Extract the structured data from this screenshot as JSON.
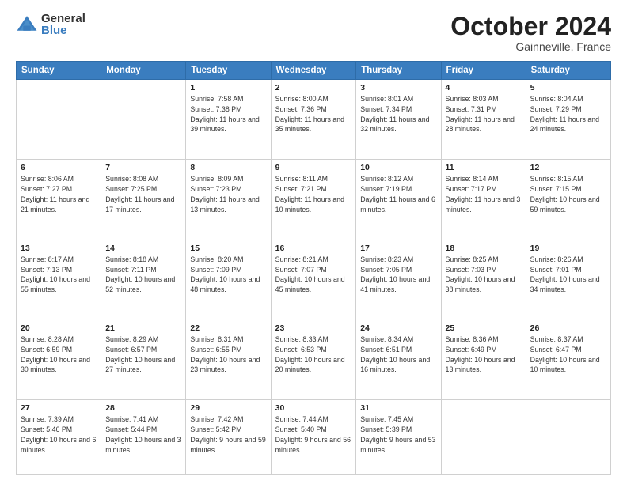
{
  "logo": {
    "general": "General",
    "blue": "Blue"
  },
  "header": {
    "month": "October 2024",
    "location": "Gainneville, France"
  },
  "weekdays": [
    "Sunday",
    "Monday",
    "Tuesday",
    "Wednesday",
    "Thursday",
    "Friday",
    "Saturday"
  ],
  "weeks": [
    [
      {
        "day": "",
        "sunrise": "",
        "sunset": "",
        "daylight": ""
      },
      {
        "day": "",
        "sunrise": "",
        "sunset": "",
        "daylight": ""
      },
      {
        "day": "1",
        "sunrise": "Sunrise: 7:58 AM",
        "sunset": "Sunset: 7:38 PM",
        "daylight": "Daylight: 11 hours and 39 minutes."
      },
      {
        "day": "2",
        "sunrise": "Sunrise: 8:00 AM",
        "sunset": "Sunset: 7:36 PM",
        "daylight": "Daylight: 11 hours and 35 minutes."
      },
      {
        "day": "3",
        "sunrise": "Sunrise: 8:01 AM",
        "sunset": "Sunset: 7:34 PM",
        "daylight": "Daylight: 11 hours and 32 minutes."
      },
      {
        "day": "4",
        "sunrise": "Sunrise: 8:03 AM",
        "sunset": "Sunset: 7:31 PM",
        "daylight": "Daylight: 11 hours and 28 minutes."
      },
      {
        "day": "5",
        "sunrise": "Sunrise: 8:04 AM",
        "sunset": "Sunset: 7:29 PM",
        "daylight": "Daylight: 11 hours and 24 minutes."
      }
    ],
    [
      {
        "day": "6",
        "sunrise": "Sunrise: 8:06 AM",
        "sunset": "Sunset: 7:27 PM",
        "daylight": "Daylight: 11 hours and 21 minutes."
      },
      {
        "day": "7",
        "sunrise": "Sunrise: 8:08 AM",
        "sunset": "Sunset: 7:25 PM",
        "daylight": "Daylight: 11 hours and 17 minutes."
      },
      {
        "day": "8",
        "sunrise": "Sunrise: 8:09 AM",
        "sunset": "Sunset: 7:23 PM",
        "daylight": "Daylight: 11 hours and 13 minutes."
      },
      {
        "day": "9",
        "sunrise": "Sunrise: 8:11 AM",
        "sunset": "Sunset: 7:21 PM",
        "daylight": "Daylight: 11 hours and 10 minutes."
      },
      {
        "day": "10",
        "sunrise": "Sunrise: 8:12 AM",
        "sunset": "Sunset: 7:19 PM",
        "daylight": "Daylight: 11 hours and 6 minutes."
      },
      {
        "day": "11",
        "sunrise": "Sunrise: 8:14 AM",
        "sunset": "Sunset: 7:17 PM",
        "daylight": "Daylight: 11 hours and 3 minutes."
      },
      {
        "day": "12",
        "sunrise": "Sunrise: 8:15 AM",
        "sunset": "Sunset: 7:15 PM",
        "daylight": "Daylight: 10 hours and 59 minutes."
      }
    ],
    [
      {
        "day": "13",
        "sunrise": "Sunrise: 8:17 AM",
        "sunset": "Sunset: 7:13 PM",
        "daylight": "Daylight: 10 hours and 55 minutes."
      },
      {
        "day": "14",
        "sunrise": "Sunrise: 8:18 AM",
        "sunset": "Sunset: 7:11 PM",
        "daylight": "Daylight: 10 hours and 52 minutes."
      },
      {
        "day": "15",
        "sunrise": "Sunrise: 8:20 AM",
        "sunset": "Sunset: 7:09 PM",
        "daylight": "Daylight: 10 hours and 48 minutes."
      },
      {
        "day": "16",
        "sunrise": "Sunrise: 8:21 AM",
        "sunset": "Sunset: 7:07 PM",
        "daylight": "Daylight: 10 hours and 45 minutes."
      },
      {
        "day": "17",
        "sunrise": "Sunrise: 8:23 AM",
        "sunset": "Sunset: 7:05 PM",
        "daylight": "Daylight: 10 hours and 41 minutes."
      },
      {
        "day": "18",
        "sunrise": "Sunrise: 8:25 AM",
        "sunset": "Sunset: 7:03 PM",
        "daylight": "Daylight: 10 hours and 38 minutes."
      },
      {
        "day": "19",
        "sunrise": "Sunrise: 8:26 AM",
        "sunset": "Sunset: 7:01 PM",
        "daylight": "Daylight: 10 hours and 34 minutes."
      }
    ],
    [
      {
        "day": "20",
        "sunrise": "Sunrise: 8:28 AM",
        "sunset": "Sunset: 6:59 PM",
        "daylight": "Daylight: 10 hours and 30 minutes."
      },
      {
        "day": "21",
        "sunrise": "Sunrise: 8:29 AM",
        "sunset": "Sunset: 6:57 PM",
        "daylight": "Daylight: 10 hours and 27 minutes."
      },
      {
        "day": "22",
        "sunrise": "Sunrise: 8:31 AM",
        "sunset": "Sunset: 6:55 PM",
        "daylight": "Daylight: 10 hours and 23 minutes."
      },
      {
        "day": "23",
        "sunrise": "Sunrise: 8:33 AM",
        "sunset": "Sunset: 6:53 PM",
        "daylight": "Daylight: 10 hours and 20 minutes."
      },
      {
        "day": "24",
        "sunrise": "Sunrise: 8:34 AM",
        "sunset": "Sunset: 6:51 PM",
        "daylight": "Daylight: 10 hours and 16 minutes."
      },
      {
        "day": "25",
        "sunrise": "Sunrise: 8:36 AM",
        "sunset": "Sunset: 6:49 PM",
        "daylight": "Daylight: 10 hours and 13 minutes."
      },
      {
        "day": "26",
        "sunrise": "Sunrise: 8:37 AM",
        "sunset": "Sunset: 6:47 PM",
        "daylight": "Daylight: 10 hours and 10 minutes."
      }
    ],
    [
      {
        "day": "27",
        "sunrise": "Sunrise: 7:39 AM",
        "sunset": "Sunset: 5:46 PM",
        "daylight": "Daylight: 10 hours and 6 minutes."
      },
      {
        "day": "28",
        "sunrise": "Sunrise: 7:41 AM",
        "sunset": "Sunset: 5:44 PM",
        "daylight": "Daylight: 10 hours and 3 minutes."
      },
      {
        "day": "29",
        "sunrise": "Sunrise: 7:42 AM",
        "sunset": "Sunset: 5:42 PM",
        "daylight": "Daylight: 9 hours and 59 minutes."
      },
      {
        "day": "30",
        "sunrise": "Sunrise: 7:44 AM",
        "sunset": "Sunset: 5:40 PM",
        "daylight": "Daylight: 9 hours and 56 minutes."
      },
      {
        "day": "31",
        "sunrise": "Sunrise: 7:45 AM",
        "sunset": "Sunset: 5:39 PM",
        "daylight": "Daylight: 9 hours and 53 minutes."
      },
      {
        "day": "",
        "sunrise": "",
        "sunset": "",
        "daylight": ""
      },
      {
        "day": "",
        "sunrise": "",
        "sunset": "",
        "daylight": ""
      }
    ]
  ]
}
